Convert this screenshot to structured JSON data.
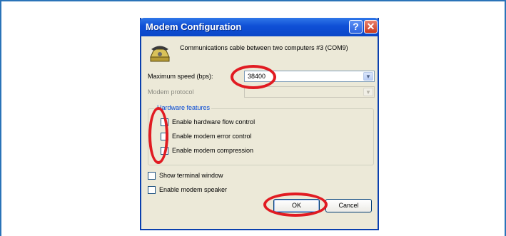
{
  "dialog": {
    "title": "Modem Configuration",
    "help_glyph": "?",
    "close_glyph": "✕",
    "header": "Communications cable between two computers #3 (COM9)"
  },
  "fields": {
    "max_speed_label": "Maximum speed (bps):",
    "max_speed_value": "38400",
    "protocol_label": "Modem protocol",
    "protocol_value": ""
  },
  "hardware": {
    "title": "Hardware features",
    "items": [
      {
        "label": "Enable hardware flow control",
        "checked": false
      },
      {
        "label": "Enable modem error control",
        "checked": false
      },
      {
        "label": "Enable modem compression",
        "checked": false
      }
    ]
  },
  "options": [
    {
      "label": "Show terminal window",
      "checked": false
    },
    {
      "label": "Enable modem speaker",
      "checked": false
    }
  ],
  "buttons": {
    "ok": "OK",
    "cancel": "Cancel"
  },
  "icons": {
    "dropdown_arrow": "▼"
  },
  "colors": {
    "annotation_ring": "#e11b22",
    "titlebar": "#0a47c8",
    "dialog_bg": "#ece9d8"
  }
}
